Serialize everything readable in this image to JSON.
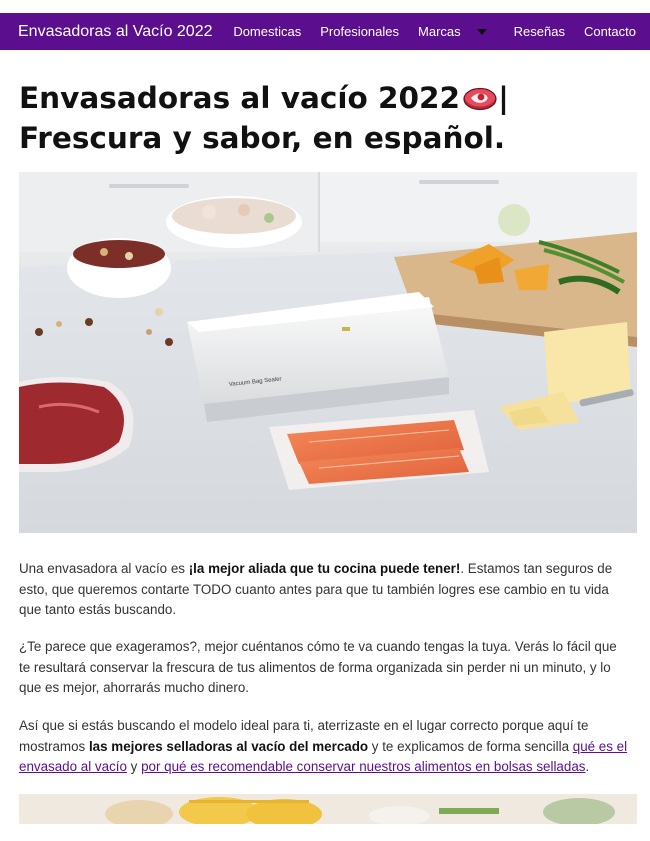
{
  "navbar": {
    "brand": "Envasadoras al Vacío 2022",
    "links": [
      "Domesticas",
      "Profesionales",
      "Marcas",
      "Reseñas",
      "Contacto"
    ],
    "dropdown_icon": "chevron-down-icon"
  },
  "title": {
    "part1": "Envasadoras al vacío 2022",
    "part2": "| Frescura y sabor, en español.",
    "emoji_icon": "meat-icon"
  },
  "hero": {
    "device_label": "Vacuum Bag Sealer"
  },
  "content": {
    "p1": {
      "before": "Una envasadora al vacío es ",
      "bold": "¡la mejor aliada que tu cocina puede tener!",
      "after": ". Estamos tan seguros de esto, que queremos contarte TODO cuanto antes para que tu también logres ese cambio en tu vida que tanto estás buscando."
    },
    "p2": "¿Te parece que exageramos?, mejor cuéntanos cómo te va cuando tengas la tuya. Verás lo fácil que te resultará conservar la frescura de tus alimentos de forma organizada sin perder ni un minuto, y lo que es mejor, ahorrarás mucho dinero.",
    "p3": {
      "before": "Así que si estás buscando el modelo ideal para ti, aterrizaste en el lugar correcto porque aquí te mostramos ",
      "bold": "las mejores selladoras al vacío del mercado",
      "middle": " y te explicamos de forma sencilla ",
      "link1": "qué es el envasado al vacío",
      "conj": " y ",
      "link2": "por qué es recomendable conservar nuestros alimentos en bolsas selladas",
      "end": "."
    }
  },
  "colors": {
    "nav_bg": "#5b0f8f",
    "link": "#5b0f8f"
  }
}
